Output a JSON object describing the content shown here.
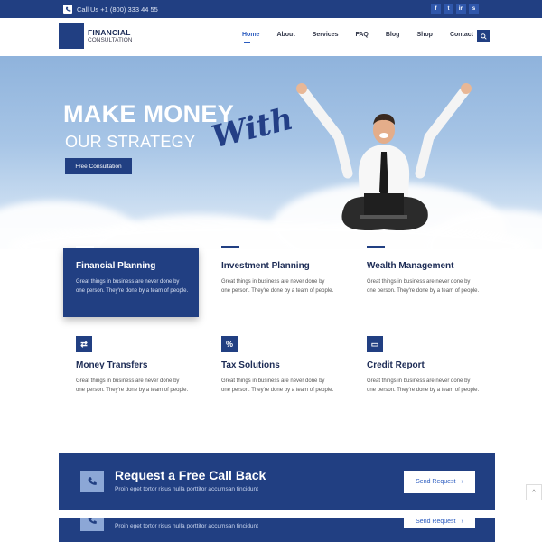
{
  "topbar": {
    "phone": "Call Us +1 (800) 333 44 55",
    "socials": [
      {
        "icon": "facebook-icon",
        "glyph": "f"
      },
      {
        "icon": "twitter-icon",
        "glyph": "t"
      },
      {
        "icon": "linkedin-icon",
        "glyph": "in"
      },
      {
        "icon": "skype-icon",
        "glyph": "s"
      }
    ]
  },
  "logo": {
    "line1": "FINANCIAL",
    "line2": "CONSULTATION"
  },
  "nav": {
    "items": [
      "Home",
      "About",
      "Services",
      "FAQ",
      "Blog",
      "Shop",
      "Contact"
    ],
    "active": "Home"
  },
  "hero": {
    "title1": "MAKE MONEY",
    "title2": "OUR STRATEGY",
    "script": "With",
    "button": "Free Consultation"
  },
  "services": [
    {
      "title": "Financial Planning",
      "text": "Great things in business are never done by one person. They're done by a team of people.",
      "icon": "none"
    },
    {
      "title": "Investment Planning",
      "text": "Great things in business are never done by one person. They're done by a team of people.",
      "icon": "none"
    },
    {
      "title": "Wealth Management",
      "text": "Great things in business are never done by one person. They're done by a team of people.",
      "icon": "none"
    },
    {
      "title": "Money Transfers",
      "text": "Great things in business are never done by one person. They're done by a team of people.",
      "icon": "exchange-icon",
      "glyph": "⇄"
    },
    {
      "title": "Tax Solutions",
      "text": "Great things in business are never done by one person. They're done by a team of people.",
      "icon": "percent-icon",
      "glyph": "%"
    },
    {
      "title": "Credit Report",
      "text": "Great things in business are never done by one person. They're done by a team of people.",
      "icon": "credit-card-icon",
      "glyph": "▭"
    }
  ],
  "cta": {
    "title": "Request a Free Call Back",
    "subtitle": "Proin eget tortor risus nulla porttitor accumsan tincidunt",
    "button": "Send Request",
    "button_arrow": "›"
  },
  "scroll_top": {
    "glyph": "^"
  },
  "colors": {
    "brand": "#213f82",
    "accent": "#2a5bbf",
    "sky": "#a7c5e6"
  }
}
